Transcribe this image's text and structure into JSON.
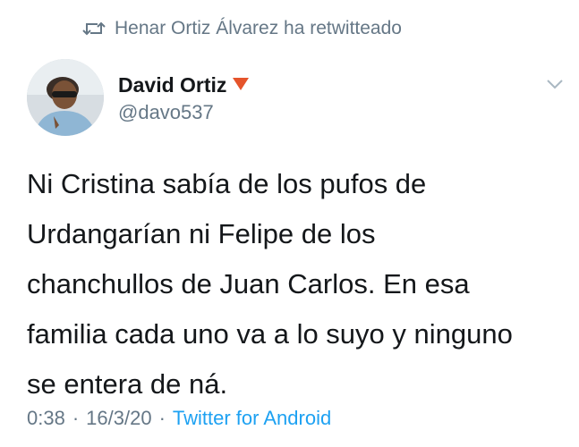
{
  "retweet": {
    "icon": "retweet-icon",
    "text": "Henar Ortiz Álvarez ha retwitteado"
  },
  "author": {
    "name": "David Ortiz",
    "badge_icon": "red-triangle-icon",
    "handle": "@davo537"
  },
  "menu_icon": "chevron-down-icon",
  "tweet": {
    "lines": [
      "Ni Cristina sabía de los pufos de",
      "Urdangarían ni Felipe de los",
      "chanchullos de Juan Carlos. En esa",
      "familia cada uno va a lo suyo y ninguno",
      "se entera de ná."
    ]
  },
  "meta": {
    "time": "0:38",
    "sep1": "·",
    "date": "16/3/20",
    "sep2": "·",
    "source": "Twitter for Android"
  },
  "colors": {
    "text": "#14171a",
    "secondary": "#657786",
    "link": "#1da1f2",
    "badge": "#e0245e"
  }
}
